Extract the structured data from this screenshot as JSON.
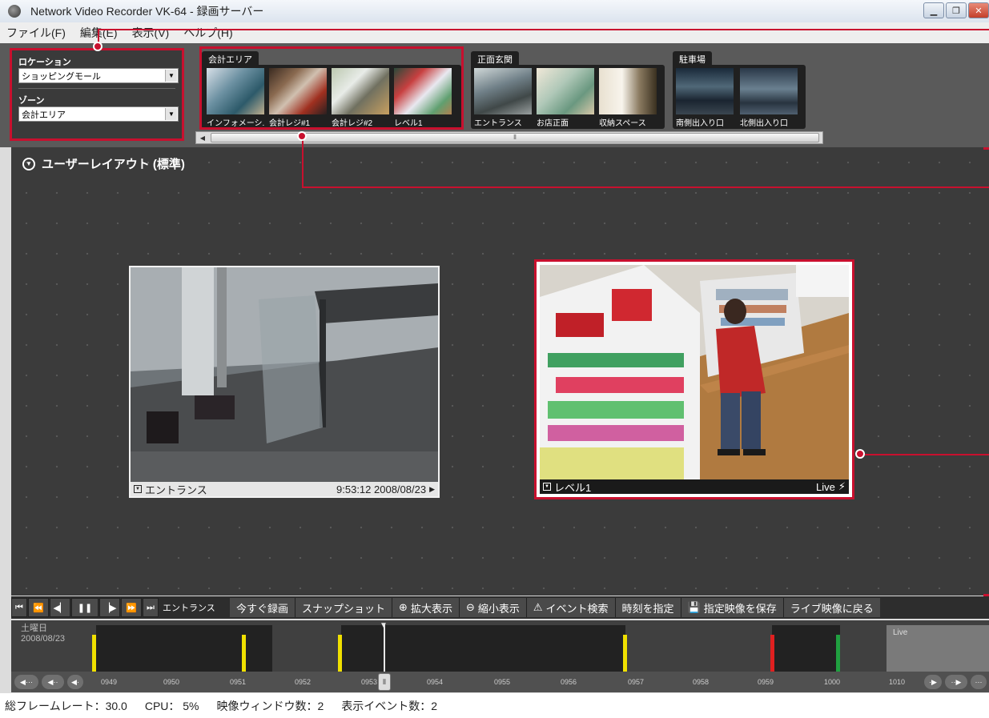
{
  "window": {
    "title": "Network Video Recorder VK-64 - 録画サーバー"
  },
  "menu": [
    "ファイル(F)",
    "編集(E)",
    "表示(V)",
    "ヘルプ(H)"
  ],
  "location_panel": {
    "location_label": "ロケーション",
    "location_value": "ショッピングモール",
    "zone_label": "ゾーン",
    "zone_value": "会計エリア"
  },
  "zones": [
    {
      "name": "会計エリア",
      "cameras": [
        "インフォメーシ...",
        "会計レジ#1",
        "会計レジ#2",
        "レベル1"
      ]
    },
    {
      "name": "正面玄関",
      "cameras": [
        "エントランス",
        "お店正面",
        "収納スペース"
      ]
    },
    {
      "name": "駐車場",
      "cameras": [
        "南側出入り口",
        "北側出入り口"
      ]
    }
  ],
  "main": {
    "layout_title": "ユーザーレイアウト (標準)"
  },
  "camera_views": [
    {
      "name": "エントランス",
      "timestamp": "9:53:12 2008/08/23"
    },
    {
      "name": "レベル1",
      "status": "Live"
    }
  ],
  "transport": {
    "current_camera": "エントランス",
    "actions": [
      "今すぐ録画",
      "スナップショット",
      "拡大表示",
      "縮小表示",
      "イベント検索",
      "時刻を指定",
      "指定映像を保存",
      "ライブ映像に戻る"
    ]
  },
  "timeline": {
    "day": "土曜日",
    "date": "2008/08/23",
    "live_label": "Live",
    "ticks": [
      "0949",
      "0950",
      "0951",
      "0952",
      "0953",
      "0954",
      "0955",
      "0956",
      "0957",
      "0958",
      "0959",
      "1000",
      "1010"
    ],
    "marker_colors": {
      "event": "#f0e000",
      "alarm": "#e02020",
      "ok": "#20a040"
    }
  },
  "status": {
    "frame_rate": "総フレームレート：30.0",
    "cpu": "CPU： 5%",
    "windows": "映像ウィンドウ数：2",
    "events": "表示イベント数：2"
  },
  "colors": {
    "callout": "#c8102e"
  }
}
